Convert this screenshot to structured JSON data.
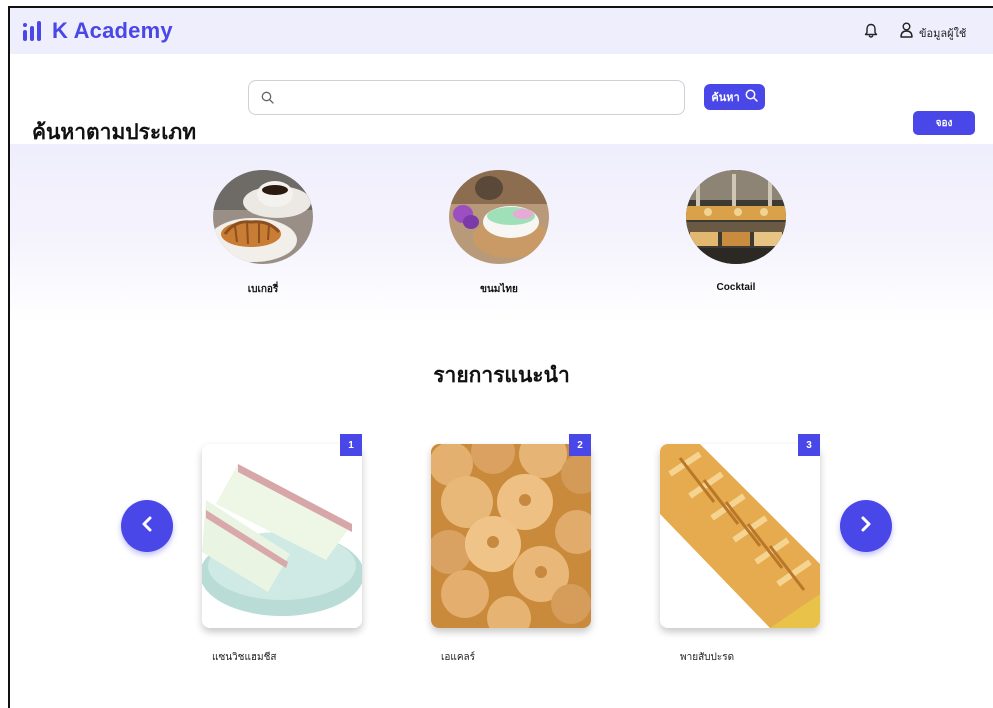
{
  "app": {
    "name": "K Academy"
  },
  "header": {
    "user_label": "ข้อมูลผู้ใช้",
    "icons": {
      "notification": "bell-icon",
      "user": "user-icon"
    }
  },
  "search": {
    "placeholder": "",
    "value": "",
    "button_label": "ค้นหา",
    "icon": "search-icon"
  },
  "categories": {
    "title": "ค้นหาตามประเภท",
    "book_button_label": "จอง",
    "items": [
      {
        "label": "เบเกอรี่",
        "image": "coffee-and-croissant"
      },
      {
        "label": "ขนมไทย",
        "image": "thai-dessert-bowl"
      },
      {
        "label": "Cocktail",
        "image": "buffet-spread"
      }
    ]
  },
  "recommended": {
    "title": "รายการแนะนำ",
    "prev_icon": "chevron-left-icon",
    "next_icon": "chevron-right-icon",
    "items": [
      {
        "rank": "1",
        "label": "แซนวิชแฮมชีส",
        "image": "ham-cheese-sandwich"
      },
      {
        "rank": "2",
        "label": "เอแคลร์",
        "image": "eclairs"
      },
      {
        "rank": "3",
        "label": "พายสับปะรด",
        "image": "pineapple-pie"
      }
    ]
  },
  "colors": {
    "accent": "#4a47e8",
    "nav_background": "#efeefc"
  }
}
